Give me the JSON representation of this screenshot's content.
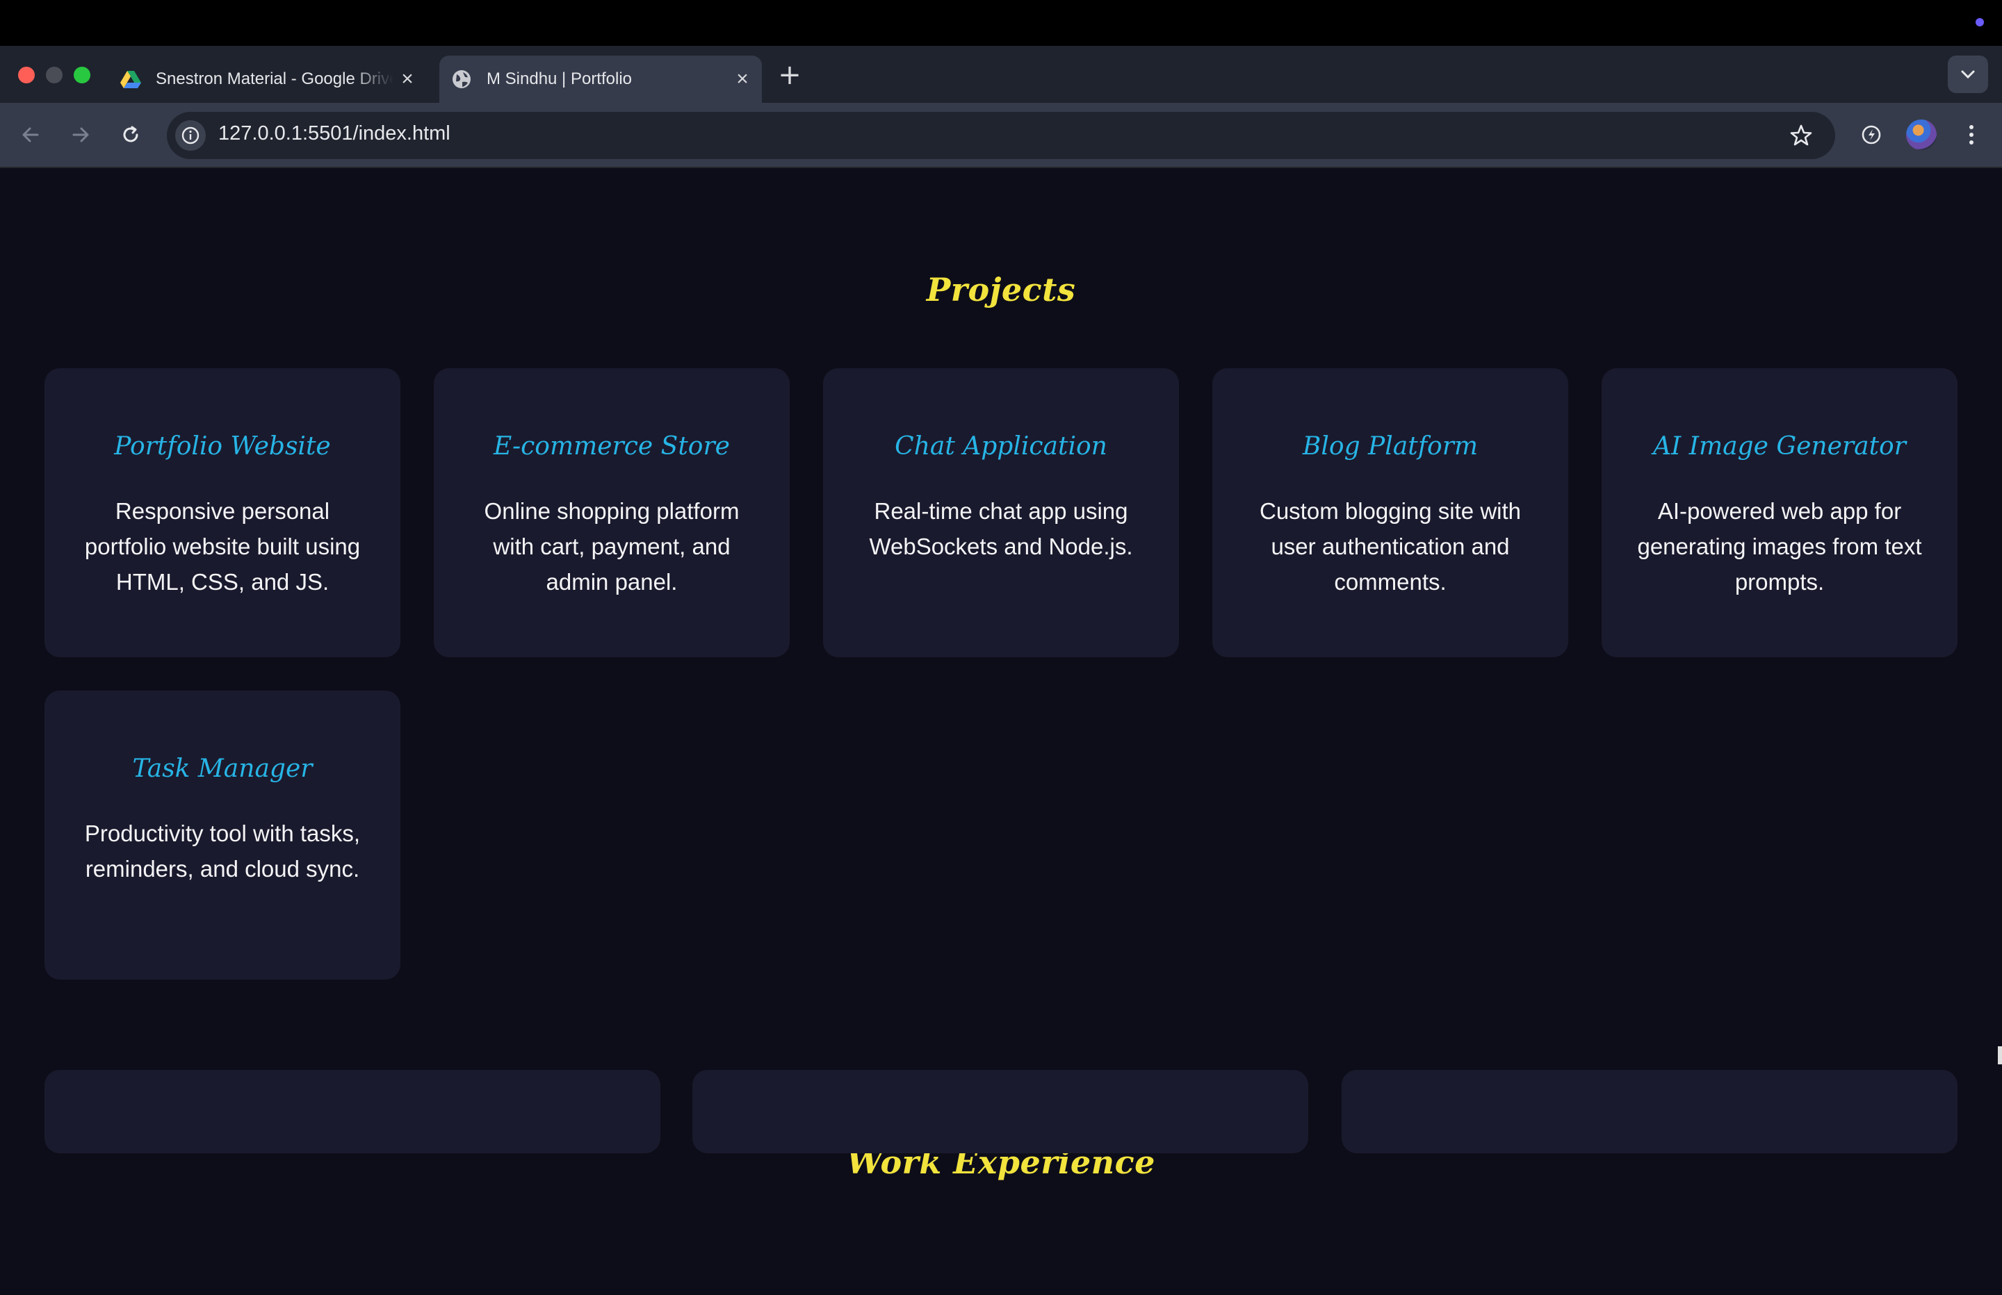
{
  "browser": {
    "tabs": [
      {
        "title": "Snestron Material - Google Drive",
        "favicon": "google-drive-icon",
        "active": false
      },
      {
        "title": "M Sindhu | Portfolio",
        "favicon": "globe-icon",
        "active": true
      }
    ],
    "url": "127.0.0.1:5501/index.html"
  },
  "page": {
    "projects_title": "Projects",
    "projects": [
      {
        "title": "Portfolio Website",
        "description": "Responsive personal portfolio website built using HTML, CSS, and JS."
      },
      {
        "title": "E-commerce Store",
        "description": "Online shopping platform with cart, payment, and admin panel."
      },
      {
        "title": "Chat Application",
        "description": "Real-time chat app using WebSockets and Node.js."
      },
      {
        "title": "Blog Platform",
        "description": "Custom blogging site with user authentication and comments."
      },
      {
        "title": "AI Image Generator",
        "description": "AI-powered web app for generating images from text prompts."
      },
      {
        "title": "Task Manager",
        "description": "Productivity tool with tasks, reminders, and cloud sync."
      }
    ],
    "work_title": "Work Experience"
  },
  "colors": {
    "page_bg": "#0d0d19",
    "card_bg": "#1a1a2e",
    "section_title": "#f2e33d",
    "project_title": "#27b5e6",
    "text": "#f4f4f6"
  }
}
